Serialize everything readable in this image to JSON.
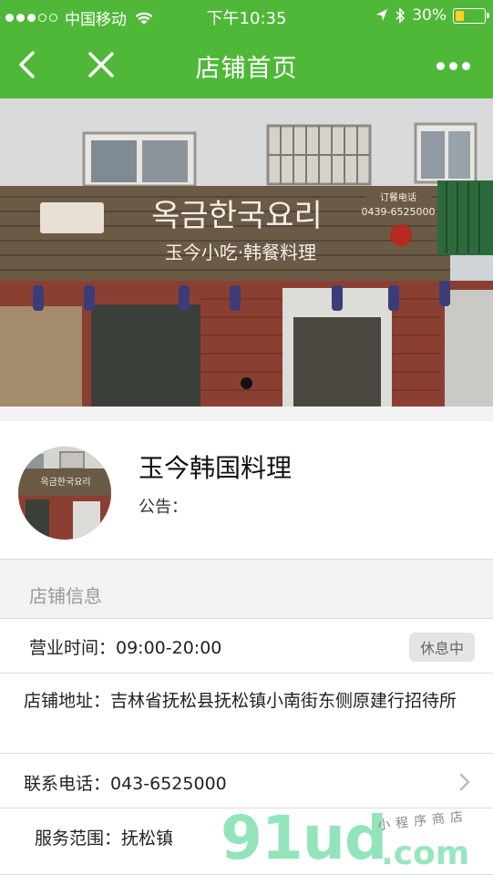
{
  "status_bar": {
    "carrier": "中国移动",
    "time": "下午10:35",
    "battery_percent": "30%",
    "battery_level": 0.3,
    "signal_bars_filled": 3,
    "signal_bars_total": 5,
    "accent_color": "#4fb838",
    "battery_color": "#ffd21e"
  },
  "nav": {
    "title": "店铺首页",
    "back_icon": "chevron-left-icon",
    "close_icon": "close-icon",
    "more_icon": "more-dots-icon"
  },
  "banner": {
    "sign_korean": "옥금한국요리",
    "sign_chinese": "玉今小吃·韩餐料理",
    "order_phone_label": "订餐电话",
    "order_phone": "0439-6525000"
  },
  "store": {
    "name": "玉今韩国料理",
    "notice_label": "公告："
  },
  "section": {
    "title": "店铺信息"
  },
  "info": {
    "hours": "营业时间：09:00-20:00",
    "status": "休息中",
    "address": "店铺地址：吉林省抚松县抚松镇小南街东侧原建行招待所",
    "phone": "联系电话：043-6525000",
    "scope": "服务范围：抚松镇"
  },
  "watermark": {
    "main": "91ud",
    "suffix": ".com",
    "tagline": "小程序商店"
  }
}
